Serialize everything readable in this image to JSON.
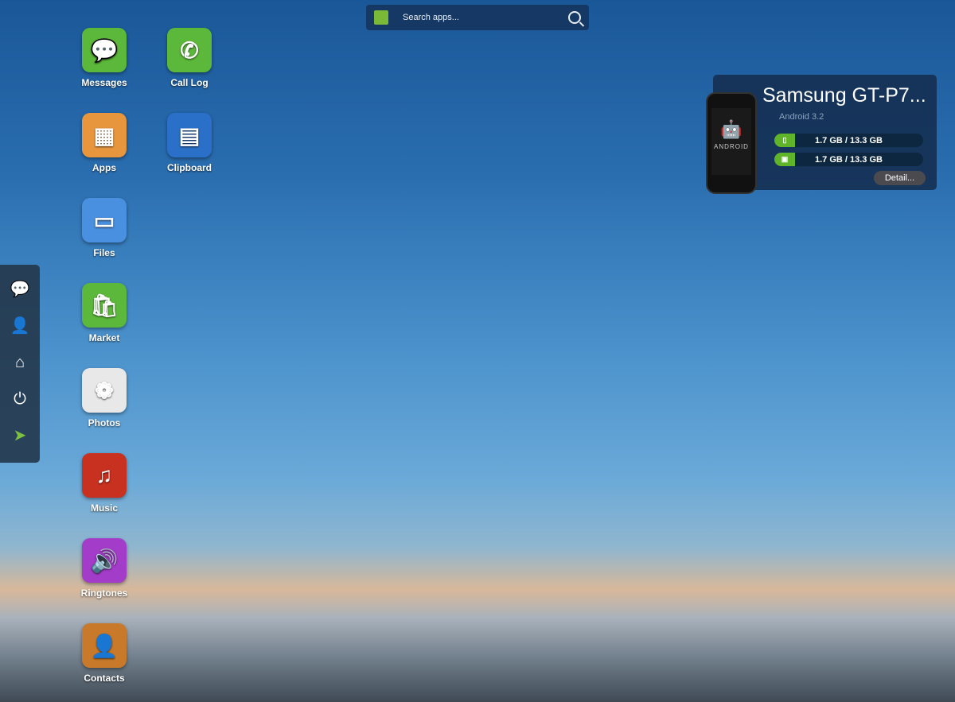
{
  "search": {
    "placeholder": "Search apps...",
    "icon": "search-icon"
  },
  "apps": [
    {
      "label": "Messages",
      "color": "#5cb83a",
      "glyph": "💬"
    },
    {
      "label": "Call Log",
      "color": "#5cb83a",
      "glyph": "✆"
    },
    {
      "label": "Apps",
      "color": "#e8963e",
      "glyph": "▦"
    },
    {
      "label": "Clipboard",
      "color": "#2a70c8",
      "glyph": "▤"
    },
    {
      "label": "Files",
      "color": "#4a90e0",
      "glyph": "▭"
    },
    {
      "label": "Market",
      "color": "#5cb83a",
      "glyph": "🛍"
    },
    {
      "label": "Photos",
      "color": "#e8e8e8",
      "glyph": "❁"
    },
    {
      "label": "Music",
      "color": "#c83020",
      "glyph": "♫"
    },
    {
      "label": "Ringtones",
      "color": "#a33cc8",
      "glyph": "🔊"
    },
    {
      "label": "Contacts",
      "color": "#c87a2a",
      "glyph": "👤"
    }
  ],
  "dock": [
    {
      "name": "new-message-icon",
      "glyph": "💬"
    },
    {
      "name": "add-contact-icon",
      "glyph": "👤"
    },
    {
      "name": "home-icon",
      "glyph": "⌂"
    },
    {
      "name": "power-icon",
      "glyph": "⏻"
    },
    {
      "name": "airdroid-logo-icon",
      "glyph": "➤"
    }
  ],
  "device": {
    "name": "Samsung GT-P7...",
    "os": "Android 3.2",
    "phone_text": "ANDROID",
    "storage": [
      {
        "icon": "phone-storage-icon",
        "text": "1.7 GB / 13.3 GB"
      },
      {
        "icon": "sd-card-icon",
        "text": "1.7 GB / 13.3 GB"
      }
    ],
    "detail_label": "Detail..."
  }
}
